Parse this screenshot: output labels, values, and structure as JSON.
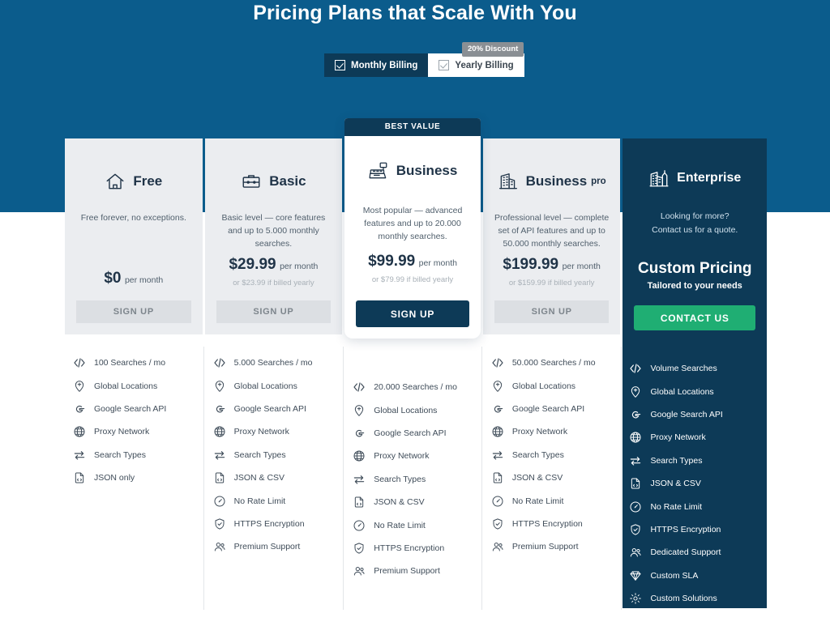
{
  "header": {
    "title": "Pricing Plans that Scale With You"
  },
  "billing": {
    "monthly_label": "Monthly Billing",
    "yearly_label": "Yearly Billing",
    "discount_badge": "20% Discount",
    "selected": "Monthly Billing"
  },
  "badges": {
    "best_value": "BEST VALUE"
  },
  "colors": {
    "hero_blue": "#0b5c8c",
    "dark_navy": "#0d3a57",
    "card_gray": "#ebedf0",
    "green_cta": "#1fae73",
    "badge_gray": "#8a8f94"
  },
  "plans": [
    {
      "name": "Free",
      "suffix": "",
      "icon": "home-icon",
      "description": "Free forever, no exceptions.",
      "price": "$0",
      "price_period": "per month",
      "yearly_note": "",
      "cta_label": "SIGN UP",
      "featured": false,
      "features": [
        {
          "icon": "code-icon",
          "label": "100 Searches / mo"
        },
        {
          "icon": "location-pin-icon",
          "label": "Global Locations"
        },
        {
          "icon": "google-icon",
          "label": "Google Search API"
        },
        {
          "icon": "globe-icon",
          "label": "Proxy Network"
        },
        {
          "icon": "exchange-arrows-icon",
          "label": "Search Types"
        },
        {
          "icon": "file-code-icon",
          "label": "JSON only"
        }
      ]
    },
    {
      "name": "Basic",
      "suffix": "",
      "icon": "briefcase-icon",
      "description": "Basic level — core features and up to 5.000 monthly searches.",
      "price": "$29.99",
      "price_period": "per month",
      "yearly_note": "or $23.99 if billed yearly",
      "cta_label": "SIGN UP",
      "featured": false,
      "features": [
        {
          "icon": "code-icon",
          "label": "5.000 Searches / mo"
        },
        {
          "icon": "location-pin-icon",
          "label": "Global Locations"
        },
        {
          "icon": "google-icon",
          "label": "Google Search API"
        },
        {
          "icon": "globe-icon",
          "label": "Proxy Network"
        },
        {
          "icon": "exchange-arrows-icon",
          "label": "Search Types"
        },
        {
          "icon": "file-code-icon",
          "label": "JSON & CSV"
        },
        {
          "icon": "gauge-icon",
          "label": "No Rate Limit"
        },
        {
          "icon": "shield-check-icon",
          "label": "HTTPS Encryption"
        },
        {
          "icon": "users-icon",
          "label": "Premium Support"
        }
      ]
    },
    {
      "name": "Business",
      "suffix": "",
      "icon": "cash-register-icon",
      "description": "Most popular — advanced features and up to 20.000 monthly searches.",
      "price": "$99.99",
      "price_period": "per month",
      "yearly_note": "or $79.99 if billed yearly",
      "cta_label": "SIGN UP",
      "featured": true,
      "features": [
        {
          "icon": "code-icon",
          "label": "20.000 Searches / mo"
        },
        {
          "icon": "location-pin-icon",
          "label": "Global Locations"
        },
        {
          "icon": "google-icon",
          "label": "Google Search API"
        },
        {
          "icon": "globe-icon",
          "label": "Proxy Network"
        },
        {
          "icon": "exchange-arrows-icon",
          "label": "Search Types"
        },
        {
          "icon": "file-code-icon",
          "label": "JSON & CSV"
        },
        {
          "icon": "gauge-icon",
          "label": "No Rate Limit"
        },
        {
          "icon": "shield-check-icon",
          "label": "HTTPS Encryption"
        },
        {
          "icon": "users-icon",
          "label": "Premium Support"
        }
      ]
    },
    {
      "name": "Business",
      "suffix": "pro",
      "icon": "building-icon",
      "description": "Professional level — complete set of API features and up to 50.000 monthly searches.",
      "price": "$199.99",
      "price_period": "per month",
      "yearly_note": "or $159.99 if billed yearly",
      "cta_label": "SIGN UP",
      "featured": false,
      "features": [
        {
          "icon": "code-icon",
          "label": "50.000 Searches / mo"
        },
        {
          "icon": "location-pin-icon",
          "label": "Global Locations"
        },
        {
          "icon": "google-icon",
          "label": "Google Search API"
        },
        {
          "icon": "globe-icon",
          "label": "Proxy Network"
        },
        {
          "icon": "exchange-arrows-icon",
          "label": "Search Types"
        },
        {
          "icon": "file-code-icon",
          "label": "JSON & CSV"
        },
        {
          "icon": "gauge-icon",
          "label": "No Rate Limit"
        },
        {
          "icon": "shield-check-icon",
          "label": "HTTPS Encryption"
        },
        {
          "icon": "users-icon",
          "label": "Premium Support"
        }
      ]
    }
  ],
  "enterprise": {
    "name": "Enterprise",
    "icon": "skyscraper-icon",
    "description_line1": "Looking for more?",
    "description_line2": "Contact us for a quote.",
    "custom_price": "Custom Pricing",
    "custom_sub": "Tailored to your needs",
    "cta_label": "CONTACT US",
    "features": [
      {
        "icon": "code-icon",
        "label": "Volume Searches"
      },
      {
        "icon": "location-pin-icon",
        "label": "Global Locations"
      },
      {
        "icon": "google-icon",
        "label": "Google Search API"
      },
      {
        "icon": "globe-icon",
        "label": "Proxy Network"
      },
      {
        "icon": "exchange-arrows-icon",
        "label": "Search Types"
      },
      {
        "icon": "file-code-icon",
        "label": "JSON & CSV"
      },
      {
        "icon": "gauge-icon",
        "label": "No Rate Limit"
      },
      {
        "icon": "shield-check-icon",
        "label": "HTTPS Encryption"
      },
      {
        "icon": "users-icon",
        "label": "Dedicated Support"
      },
      {
        "icon": "diamond-icon",
        "label": "Custom SLA"
      },
      {
        "icon": "gear-icon",
        "label": "Custom Solutions"
      }
    ]
  }
}
